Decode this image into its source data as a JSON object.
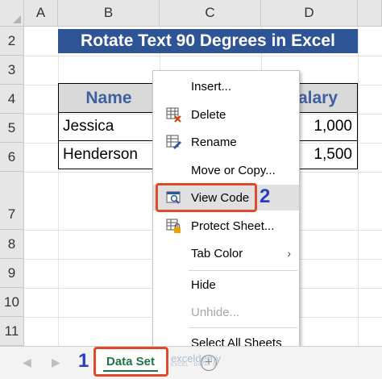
{
  "columns": [
    "A",
    "B",
    "C",
    "D"
  ],
  "rows": [
    "2",
    "3",
    "4",
    "5",
    "6",
    "7",
    "8",
    "9",
    "10",
    "11"
  ],
  "title": "Rotate Text 90 Degrees in Excel",
  "table": {
    "header_left": "Name",
    "header_right": "alary",
    "rows": [
      {
        "name": "Jessica",
        "salary": "1,000"
      },
      {
        "name": "Henderson",
        "salary": "1,500"
      }
    ]
  },
  "menu": {
    "items": [
      {
        "label": "Insert...",
        "icon": "none"
      },
      {
        "label": "Delete",
        "icon": "delete-sheet-icon"
      },
      {
        "label": "Rename",
        "icon": "rename-sheet-icon"
      },
      {
        "label": "Move or Copy...",
        "icon": "none"
      },
      {
        "label": "View Code",
        "icon": "view-code-icon"
      },
      {
        "label": "Protect Sheet...",
        "icon": "protect-sheet-icon"
      },
      {
        "label": "Tab Color",
        "icon": "none"
      },
      {
        "label": "Hide",
        "icon": "none"
      },
      {
        "label": "Unhide...",
        "icon": "none"
      },
      {
        "label": "Select All Sheets",
        "icon": "none"
      }
    ],
    "submenu_arrow": "›"
  },
  "steps": {
    "one": "1",
    "two": "2"
  },
  "sheet_tab": "Data Set",
  "watermark": {
    "line1": "exceldemy",
    "line2": "EXCEL · DATA · BI"
  },
  "add_sheet": "+",
  "nav": {
    "prev": "◀",
    "next": "▶"
  },
  "colors": {
    "title_bg": "#2f5496",
    "tab_green": "#217346",
    "highlight": "#e04a2a",
    "step": "#2a3cc7"
  }
}
